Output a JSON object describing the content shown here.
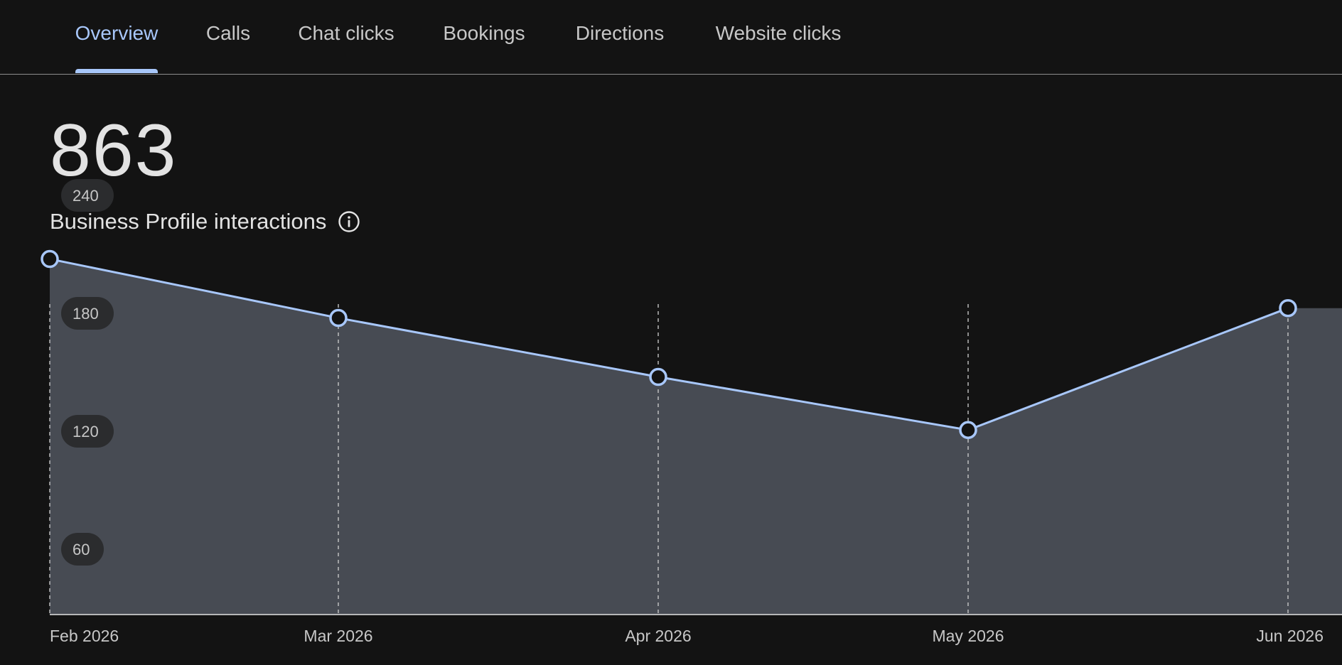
{
  "tabs": [
    {
      "label": "Overview",
      "active": true
    },
    {
      "label": "Calls",
      "active": false
    },
    {
      "label": "Chat clicks",
      "active": false
    },
    {
      "label": "Bookings",
      "active": false
    },
    {
      "label": "Directions",
      "active": false
    },
    {
      "label": "Website clicks",
      "active": false
    }
  ],
  "summary": {
    "total": "863",
    "label": "Business Profile interactions",
    "info_icon": "info-icon"
  },
  "colors": {
    "accent": "#a8c7fa",
    "area_fill": "#474b53",
    "background": "#131313"
  },
  "chart_data": {
    "type": "area",
    "categories": [
      "Feb 2026",
      "Mar 2026",
      "Apr 2026",
      "May 2026",
      "Jun 2026"
    ],
    "values": [
      208,
      178,
      148,
      121,
      183
    ],
    "yticks": [
      60,
      120,
      180,
      240
    ],
    "ylim": [
      0,
      240
    ],
    "grid": "vertical dashed at each category"
  }
}
